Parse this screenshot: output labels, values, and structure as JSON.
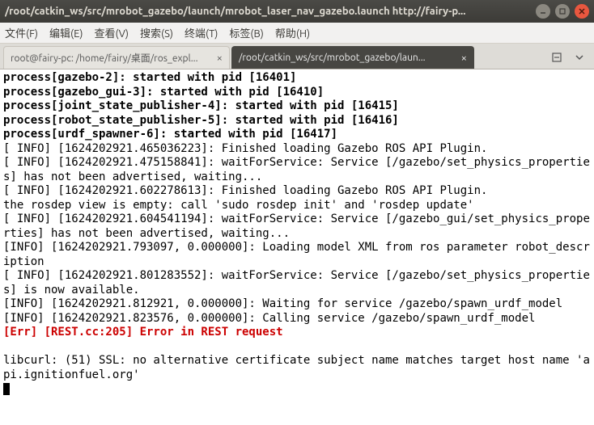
{
  "window": {
    "title": "/root/catkin_ws/src/mrobot_gazebo/launch/mrobot_laser_nav_gazebo.launch http://fairy-p..."
  },
  "menu": {
    "file": "文件(F)",
    "edit": "编辑(E)",
    "view": "查看(V)",
    "search": "搜索(S)",
    "terminal": "终端(T)",
    "tabs": "标签(B)",
    "help": "帮助(H)"
  },
  "tabs": {
    "items": [
      {
        "label": "root@fairy-pc: /home/fairy/桌面/ros_expl...",
        "active": false
      },
      {
        "label": "/root/catkin_ws/src/mrobot_gazebo/laun...",
        "active": true
      }
    ]
  },
  "terminal": {
    "lines": [
      {
        "bold": true,
        "text": "process[gazebo-2]: started with pid [16401]"
      },
      {
        "bold": true,
        "text": "process[gazebo_gui-3]: started with pid [16410]"
      },
      {
        "bold": true,
        "text": "process[joint_state_publisher-4]: started with pid [16415]"
      },
      {
        "bold": true,
        "text": "process[robot_state_publisher-5]: started with pid [16416]"
      },
      {
        "bold": true,
        "text": "process[urdf_spawner-6]: started with pid [16417]"
      },
      {
        "text": "[ INFO] [1624202921.465036223]: Finished loading Gazebo ROS API Plugin."
      },
      {
        "text": "[ INFO] [1624202921.475158841]: waitForService: Service [/gazebo/set_physics_properties] has not been advertised, waiting..."
      },
      {
        "text": "[ INFO] [1624202921.602278613]: Finished loading Gazebo ROS API Plugin."
      },
      {
        "text": "the rosdep view is empty: call 'sudo rosdep init' and 'rosdep update'"
      },
      {
        "text": "[ INFO] [1624202921.604541194]: waitForService: Service [/gazebo_gui/set_physics_properties] has not been advertised, waiting..."
      },
      {
        "text": "[INFO] [1624202921.793097, 0.000000]: Loading model XML from ros parameter robot_description"
      },
      {
        "text": "[ INFO] [1624202921.801283552]: waitForService: Service [/gazebo/set_physics_properties] is now available."
      },
      {
        "text": "[INFO] [1624202921.812921, 0.000000]: Waiting for service /gazebo/spawn_urdf_model"
      },
      {
        "text": "[INFO] [1624202921.823576, 0.000000]: Calling service /gazebo/spawn_urdf_model"
      },
      {
        "red": true,
        "text": "[Err] [REST.cc:205] Error in REST request"
      },
      {
        "text": ""
      },
      {
        "text": "libcurl: (51) SSL: no alternative certificate subject name matches target host name 'api.ignitionfuel.org'"
      }
    ]
  }
}
